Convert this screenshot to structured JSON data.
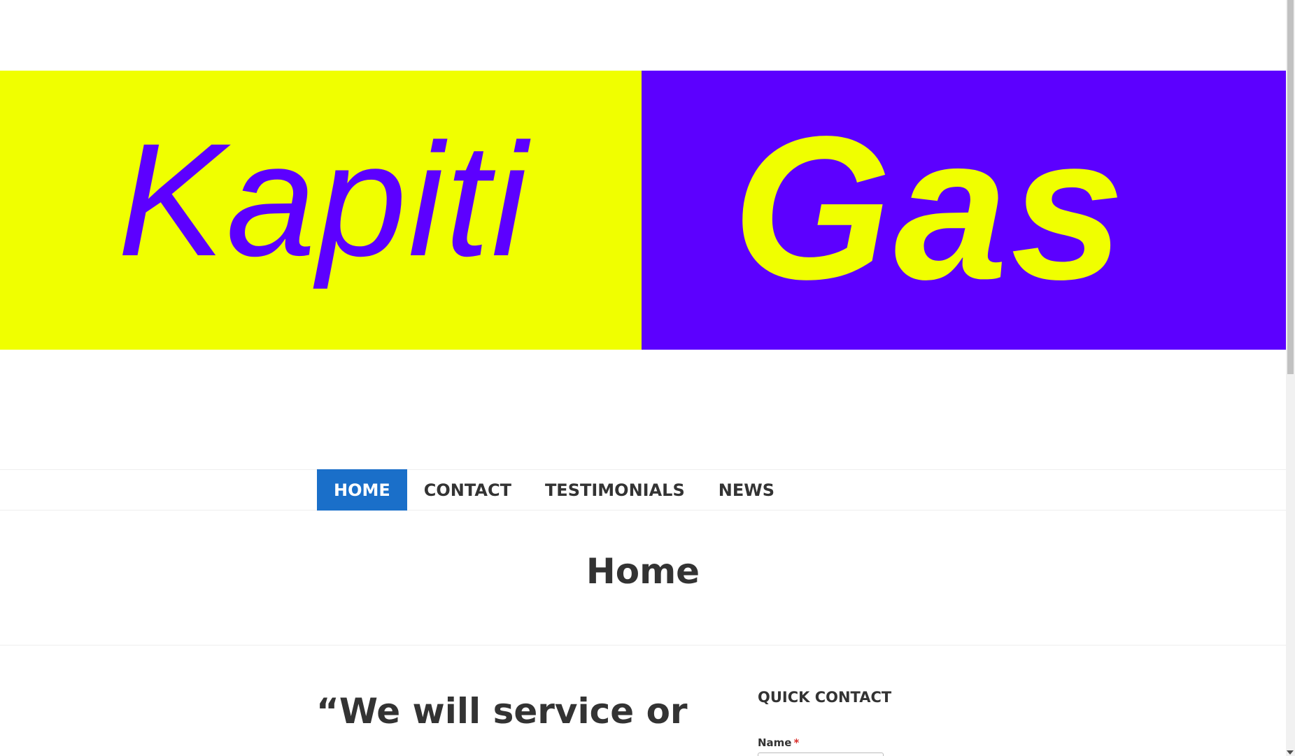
{
  "banner": {
    "left_word": "Kapiti",
    "right_word": "Gas",
    "colors": {
      "yellow": "#f0ff00",
      "purple": "#5c00ff"
    }
  },
  "nav": {
    "items": [
      {
        "label": "HOME",
        "active": true
      },
      {
        "label": "CONTACT",
        "active": false
      },
      {
        "label": "TESTIMONIALS",
        "active": false
      },
      {
        "label": "NEWS",
        "active": false
      }
    ],
    "active_color": "#1a6fc9"
  },
  "page": {
    "title": "Home"
  },
  "content": {
    "quote_line1": "“We will service or"
  },
  "sidebar": {
    "widget_title": "QUICK CONTACT",
    "name_label": "Name",
    "required_marker": "*",
    "name_value": ""
  }
}
